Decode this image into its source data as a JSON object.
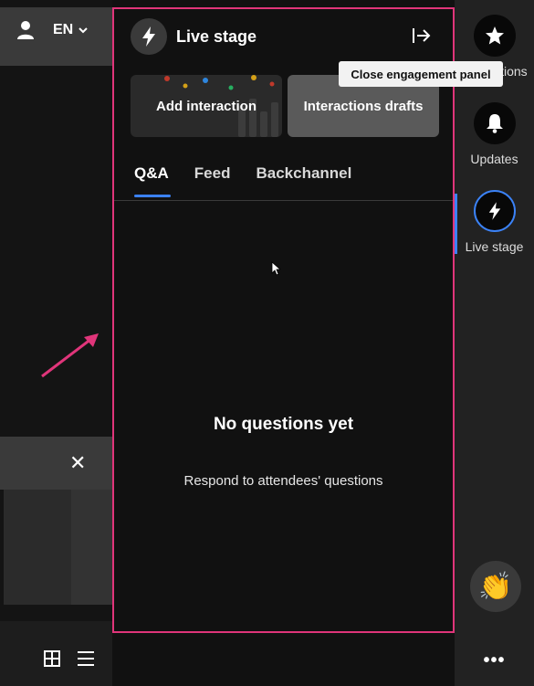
{
  "left": {
    "language": "EN",
    "close_symbol": "✕"
  },
  "panel": {
    "title": "Live stage",
    "close_tooltip": "Close engagement panel",
    "cards": [
      {
        "label": "Add interaction"
      },
      {
        "label": "Interactions drafts"
      }
    ],
    "tabs": [
      {
        "label": "Q&A",
        "active": true
      },
      {
        "label": "Feed",
        "active": false
      },
      {
        "label": "Backchannel",
        "active": false
      }
    ],
    "empty": {
      "title": "No questions yet",
      "subtitle": "Respond to attendees' questions"
    }
  },
  "rail": {
    "items": [
      {
        "label": "Interactions",
        "icon": "star-icon"
      },
      {
        "label": "Updates",
        "icon": "bell-icon"
      },
      {
        "label": "Live stage",
        "icon": "bolt-icon",
        "active": true
      }
    ],
    "more": "•••"
  },
  "colors": {
    "highlight_border": "#e0357a",
    "accent": "#3b82f6"
  }
}
